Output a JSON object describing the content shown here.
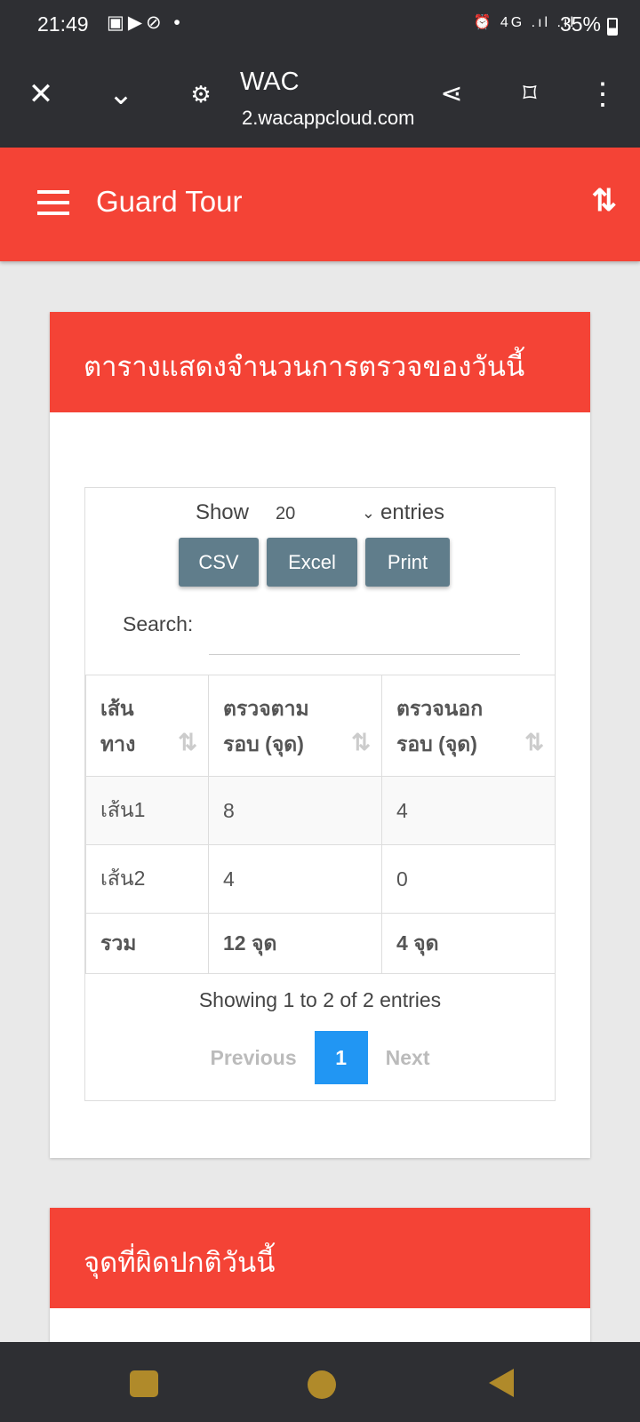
{
  "status_bar": {
    "time": "21:49",
    "battery": "35%"
  },
  "browser": {
    "title": "WAC",
    "url": "2.wacappcloud.com"
  },
  "app_bar": {
    "title": "Guard Tour"
  },
  "card1": {
    "title": "ตารางแสดงจำนวนการตรวจของวันนี้",
    "show_label": "Show",
    "entries_value": "20",
    "entries_label": "entries",
    "buttons": {
      "csv": "CSV",
      "excel": "Excel",
      "print": "Print"
    },
    "search_label": "Search:",
    "search_value": "",
    "columns": [
      [
        "เส้น",
        "ทาง"
      ],
      [
        "ตรวจตาม",
        "รอบ (จุด)"
      ],
      [
        "ตรวจนอก",
        "รอบ (จุด)"
      ]
    ],
    "rows": [
      [
        "เส้น1",
        "8",
        "4"
      ],
      [
        "เส้น2",
        "4",
        "0"
      ]
    ],
    "footer": [
      "รวม",
      "12 จุด",
      "4 จุด"
    ],
    "info": "Showing 1 to 2 of 2 entries",
    "pagination": {
      "previous": "Previous",
      "current": "1",
      "next": "Next"
    }
  },
  "card2": {
    "title": "จุดที่ผิดปกติวันนี้"
  },
  "colors": {
    "primary": "#f44336",
    "button": "#607d8b",
    "page_active": "#2196f3"
  }
}
